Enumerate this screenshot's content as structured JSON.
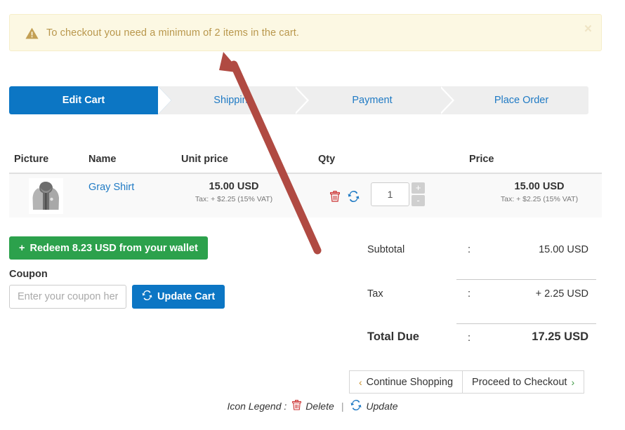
{
  "alert": {
    "icon": "warning-triangle-icon",
    "message": "To checkout you need a minimum of 2 items in the cart.",
    "close_label": "×",
    "bg_color": "#fcf8e3",
    "text_color": "#b9974c"
  },
  "steps": {
    "active_index": 0,
    "items": [
      {
        "label": "Edit Cart"
      },
      {
        "label": "Shipping"
      },
      {
        "label": "Payment"
      },
      {
        "label": "Place Order"
      }
    ],
    "active_color": "#0c76c4",
    "inactive_bg": "#eeeeee",
    "link_color": "#1f7ac4"
  },
  "cart": {
    "columns": [
      {
        "label": "Picture"
      },
      {
        "label": "Name"
      },
      {
        "label": "Unit price"
      },
      {
        "label": "Qty"
      },
      {
        "label": "Price"
      }
    ],
    "rows": [
      {
        "picture_alt": "gray-hoodie-thumbnail",
        "name": "Gray Shirt",
        "unit_price": "15.00 USD",
        "unit_tax": "Tax: + $2.25 (15% VAT)",
        "qty": "1",
        "price": "15.00 USD",
        "price_tax": "Tax: + $2.25 (15% VAT)",
        "delete_icon": "trash-icon",
        "update_icon": "refresh-icon",
        "increment_label": "+",
        "decrement_label": "-"
      }
    ]
  },
  "controls": {
    "wallet_button": "Redeem 8.23 USD from your wallet",
    "wallet_plus": "+",
    "wallet_color": "#2ca14c",
    "coupon_label": "Coupon",
    "coupon_value": "",
    "coupon_placeholder": "Enter your coupon here",
    "update_cart_button": "Update Cart",
    "update_cart_color": "#0c76c4"
  },
  "totals": {
    "colon": ":",
    "rows": [
      {
        "label": "Subtotal",
        "value": "15.00 USD"
      },
      {
        "label": "Tax",
        "value": "+ 2.25 USD"
      },
      {
        "label": "Total Due",
        "value": "17.25 USD"
      }
    ]
  },
  "footer": {
    "continue_shopping": "Continue Shopping",
    "continue_chevron": "‹",
    "proceed_checkout": "Proceed to Checkout",
    "proceed_chevron": "›",
    "back_chevron_color": "#c8912c",
    "forward_chevron_color": "#3f9b46"
  },
  "legend": {
    "title": "Icon Legend :",
    "delete_label": "Delete",
    "update_label": "Update",
    "separator": "|",
    "delete_color": "#cc3333",
    "update_color": "#1f7ac4"
  },
  "annotation": {
    "arrow_color": "#b04a42",
    "points_at": "alert-banner"
  }
}
